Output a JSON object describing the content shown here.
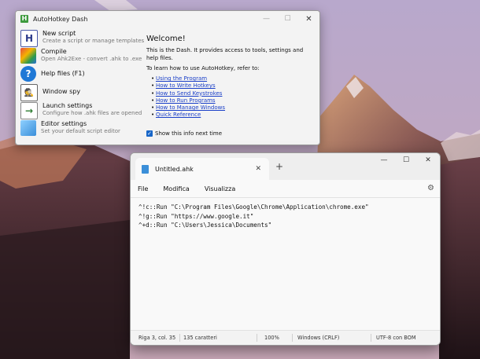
{
  "dash": {
    "title": "AutoHotkey Dash",
    "items": [
      {
        "title": "New script",
        "subtitle": "Create a script or manage templates"
      },
      {
        "title": "Compile",
        "subtitle": "Open Ahk2Exe - convert .ahk to .exe"
      },
      {
        "title": "Help files (F1)",
        "subtitle": ""
      },
      {
        "title": "Window spy",
        "subtitle": ""
      },
      {
        "title": "Launch settings",
        "subtitle": "Configure how .ahk files are opened"
      },
      {
        "title": "Editor settings",
        "subtitle": "Set your default script editor"
      }
    ],
    "welcome": "Welcome!",
    "intro": "This is the Dash. It provides access to tools, settings and help files.",
    "learn": "To learn how to use AutoHotkey, refer to:",
    "links": [
      "Using the Program",
      "How to Write Hotkeys",
      "How to Send Keystrokes",
      "How to Run Programs",
      "How to Manage Windows",
      "Quick Reference"
    ],
    "show_next_label": "Show this info next time"
  },
  "notepad": {
    "tab_title": "Untitled.ahk",
    "new_tab": "+",
    "menus": [
      "File",
      "Modifica",
      "Visualizza"
    ],
    "lines": [
      "^!c::Run \"C:\\Program Files\\Google\\Chrome\\Application\\chrome.exe\"",
      "^!g::Run \"https://www.google.it\"",
      "^+d::Run \"C:\\Users\\Jessica\\Documents\""
    ],
    "status": {
      "position": "Riga 3, col. 35",
      "chars": "135 caratteri",
      "zoom": "100%",
      "line_ending": "Windows (CRLF)",
      "encoding": "UTF-8 con BOM"
    }
  },
  "icons": {
    "new_script": "document-h-icon",
    "compile": "compile-icon",
    "help": "help-circle-icon",
    "window_spy": "spy-icon",
    "launch_settings": "arrow-right-icon",
    "editor_settings": "editor-icon"
  },
  "colors": {
    "link": "#1a3fc8",
    "checkbox": "#1866c8",
    "ahk_green": "#3d9a3d"
  }
}
